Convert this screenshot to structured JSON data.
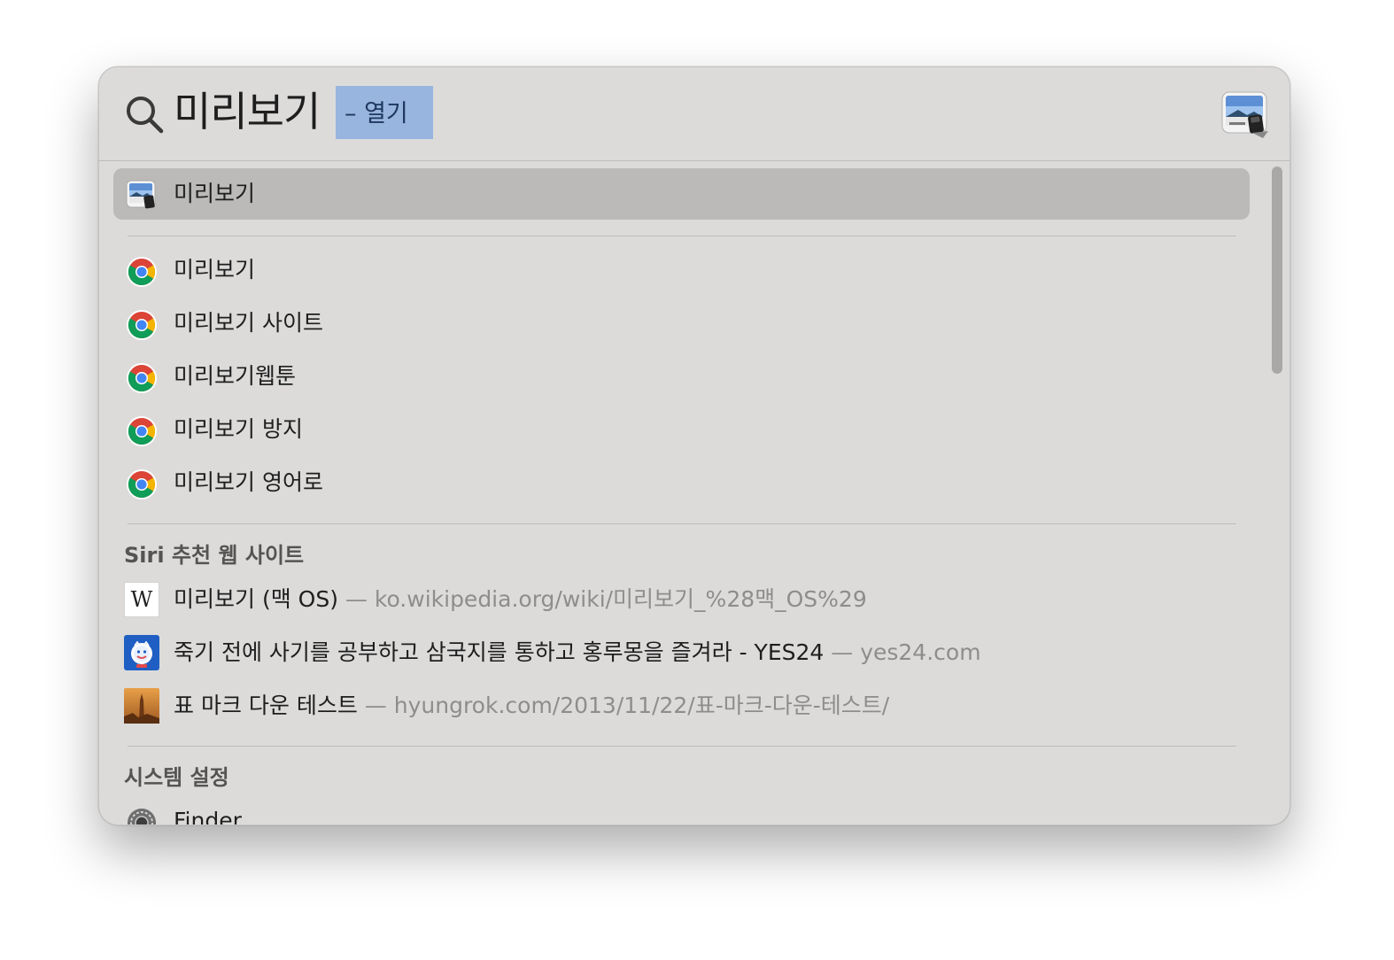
{
  "search": {
    "query": "미리보기",
    "completion": "– 열기",
    "top_hit_app_icon": "preview-app-icon"
  },
  "top_hit": {
    "label": "미리보기",
    "icon": "preview-app-icon"
  },
  "suggestions": [
    {
      "label": "미리보기",
      "icon": "chrome-icon"
    },
    {
      "label": "미리보기 사이트",
      "icon": "chrome-icon"
    },
    {
      "label": "미리보기웹툰",
      "icon": "chrome-icon"
    },
    {
      "label": "미리보기 방지",
      "icon": "chrome-icon"
    },
    {
      "label": "미리보기 영어로",
      "icon": "chrome-icon"
    }
  ],
  "siri_section": {
    "title": "Siri 추천 웹 사이트",
    "items": [
      {
        "label": "미리보기 (맥 OS)",
        "separator": "—",
        "url": "ko.wikipedia.org/wiki/미리보기_%28맥_OS%29",
        "icon": "wikipedia-icon",
        "icon_text": "W"
      },
      {
        "label": "죽기 전에 사기를 공부하고 삼국지를 통하고 홍루몽을 즐겨라 - YES24",
        "separator": "—",
        "url": "yes24.com",
        "icon": "yes24-icon"
      },
      {
        "label": "표 마크 다운 테스트",
        "separator": "—",
        "url": "hyungrok.com/2013/11/22/표-마크-다운-테스트/",
        "icon": "website-photo-icon"
      }
    ]
  },
  "system_section": {
    "title": "시스템 설정",
    "items": [
      {
        "label": "Finder",
        "icon": "system-settings-icon"
      }
    ]
  },
  "colors": {
    "window_bg": "#dcdbda",
    "selection": "#bbbab9",
    "completion_highlight": "#97b5de",
    "secondary_text": "#8e8d8c"
  }
}
